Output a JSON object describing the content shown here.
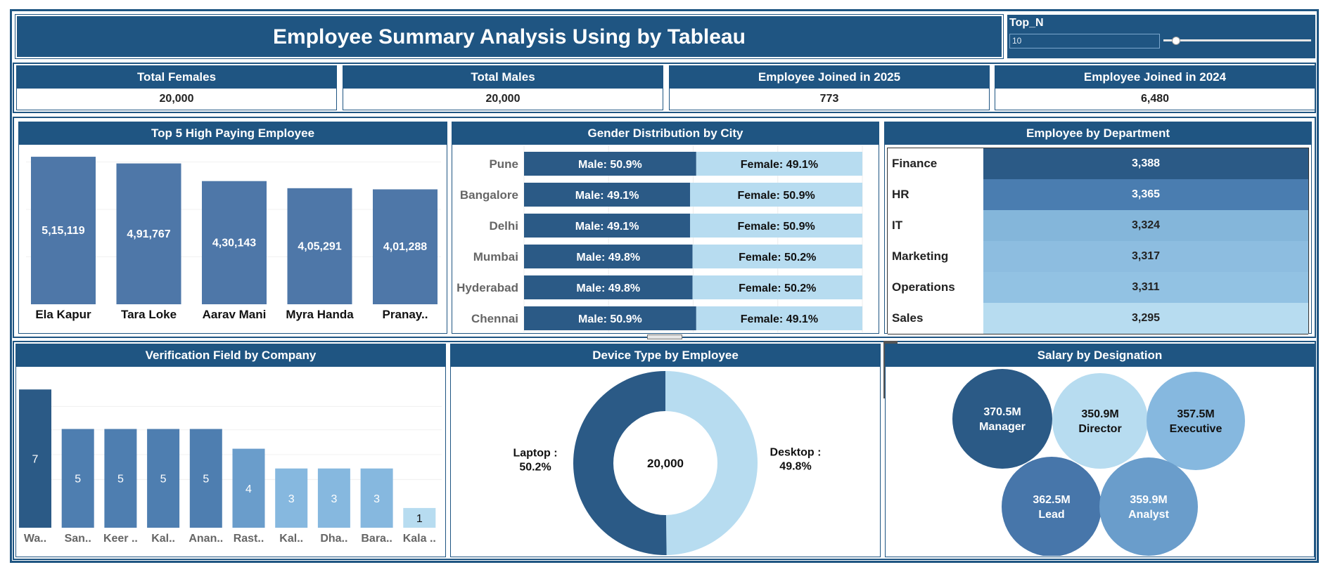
{
  "header": {
    "title": "Employee Summary Analysis Using by Tableau"
  },
  "parameter": {
    "label": "Top_N",
    "value": "10",
    "slider_fraction": 0.08
  },
  "kpis": [
    {
      "label": "Total Females",
      "value": "20,000"
    },
    {
      "label": "Total Males",
      "value": "20,000"
    },
    {
      "label": "Employee Joined in 2025",
      "value": "773"
    },
    {
      "label": "Employee Joined in 2024",
      "value": "6,480"
    }
  ],
  "top5": {
    "title": "Top 5 High Paying Employee",
    "chart_data": {
      "type": "bar",
      "categories": [
        "Ela Kapur",
        "Tara Loke",
        "Aarav Mani",
        "Myra Handa",
        "Pranay.."
      ],
      "values": [
        515119,
        491767,
        430143,
        405291,
        401288
      ],
      "labels": [
        "5,15,119",
        "4,91,767",
        "4,30,143",
        "4,05,291",
        "4,01,288"
      ],
      "ylim": [
        0,
        530000
      ]
    }
  },
  "gender_city": {
    "title": "Gender Distribution by City",
    "chart_data": {
      "type": "bar",
      "stacked": true,
      "categories": [
        "Pune",
        "Bangalore",
        "Delhi",
        "Mumbai",
        "Hyderabad",
        "Chennai"
      ],
      "series": [
        {
          "name": "Male",
          "values": [
            50.9,
            49.1,
            49.1,
            49.8,
            49.8,
            50.9
          ],
          "color": "#2b5a86"
        },
        {
          "name": "Female",
          "values": [
            49.1,
            50.9,
            50.9,
            50.2,
            50.2,
            49.1
          ],
          "color": "#b7dcf0"
        }
      ],
      "male_labels": [
        "Male: 50.9%",
        "Male: 49.1%",
        "Male: 49.1%",
        "Male: 49.8%",
        "Male: 49.8%",
        "Male: 50.9%"
      ],
      "female_labels": [
        "Female: 49.1%",
        "Female: 50.9%",
        "Female: 50.9%",
        "Female: 50.2%",
        "Female: 50.2%",
        "Female: 49.1%"
      ]
    }
  },
  "dept": {
    "title": "Employee by Department",
    "chart_data": {
      "type": "table",
      "rows": [
        {
          "name": "Finance",
          "value": "3,388",
          "color": "#2b5a86",
          "text_color": "#ffffff"
        },
        {
          "name": "HR",
          "value": "3,365",
          "color": "#4a7db0",
          "text_color": "#ffffff"
        },
        {
          "name": "IT",
          "value": "3,324",
          "color": "#84b6da",
          "text_color": "#222222"
        },
        {
          "name": "Marketing",
          "value": "3,317",
          "color": "#8dbde0",
          "text_color": "#222222"
        },
        {
          "name": "Operations",
          "value": "3,311",
          "color": "#92c2e3",
          "text_color": "#222222"
        },
        {
          "name": "Sales",
          "value": "3,295",
          "color": "#b7dcf0",
          "text_color": "#222222"
        }
      ]
    }
  },
  "verification": {
    "title": "Verification Field by Company",
    "chart_data": {
      "type": "bar",
      "categories": [
        "Wa..",
        "San..",
        "Keer ..",
        "Kal..",
        "Anan..",
        "Rast..",
        "Kal..",
        "Dha..",
        "Bara..",
        "Kala .."
      ],
      "values": [
        7,
        5,
        5,
        5,
        5,
        4,
        3,
        3,
        3,
        1
      ],
      "colors": [
        "#2b5a86",
        "#4e7eb0",
        "#4e7eb0",
        "#4e7eb0",
        "#4e7eb0",
        "#6a9dcb",
        "#86b8df",
        "#86b8df",
        "#86b8df",
        "#b7dcf0"
      ],
      "ylim": [
        0,
        7.4
      ]
    }
  },
  "device": {
    "title": "Device Type by Employee",
    "chart_data": {
      "type": "pie",
      "donut": true,
      "center_label": "20,000",
      "slices": [
        {
          "name": "Desktop",
          "value": 49.8,
          "label_line1": "Desktop :",
          "label_line2": "49.8%",
          "color": "#b7dcf0"
        },
        {
          "name": "Laptop",
          "value": 50.2,
          "label_line1": "Laptop :",
          "label_line2": "50.2%",
          "color": "#2b5a86"
        }
      ]
    }
  },
  "salary": {
    "title": "Salary by Designation",
    "chart_data": {
      "type": "bubble",
      "bubbles": [
        {
          "name": "Manager",
          "value": "370.5M",
          "color": "#2b5a86",
          "text_color": "#ffffff"
        },
        {
          "name": "Director",
          "value": "350.9M",
          "color": "#b7dcf0",
          "text_color": "#111111"
        },
        {
          "name": "Executive",
          "value": "357.5M",
          "color": "#86b8df",
          "text_color": "#111111"
        },
        {
          "name": "Lead",
          "value": "362.5M",
          "color": "#4776aa",
          "text_color": "#ffffff"
        },
        {
          "name": "Analyst",
          "value": "359.9M",
          "color": "#6a9dcb",
          "text_color": "#ffffff"
        }
      ]
    }
  },
  "toolbar": {
    "icons": [
      "close-icon",
      "popout-icon",
      "filter-icon",
      "more-options-icon"
    ]
  }
}
